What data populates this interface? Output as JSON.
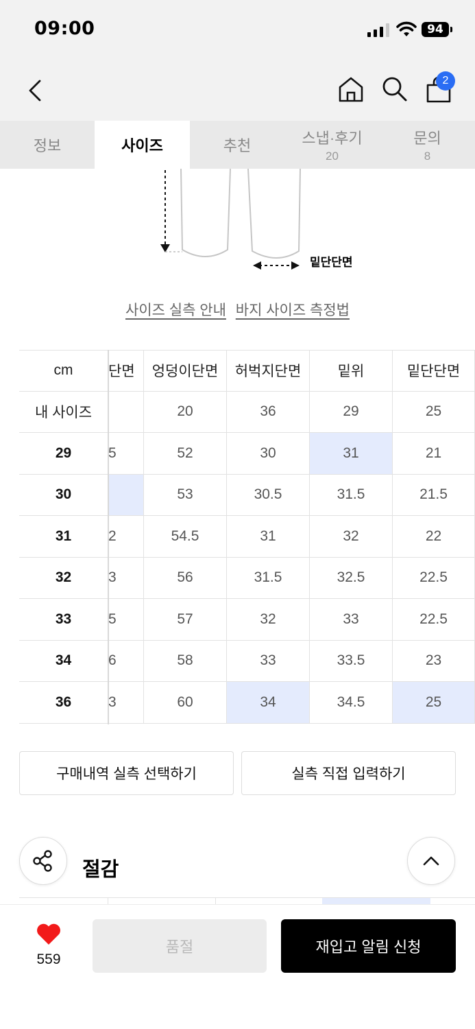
{
  "status_bar": {
    "time": "09:00",
    "battery": "94"
  },
  "nav": {
    "cart_count": "2"
  },
  "tabs": [
    {
      "label": "정보",
      "count": ""
    },
    {
      "label": "사이즈",
      "count": ""
    },
    {
      "label": "추천",
      "count": ""
    },
    {
      "label": "스냅·후기",
      "count": "20"
    },
    {
      "label": "문의",
      "count": "8"
    }
  ],
  "diagram": {
    "label": "밑단단면"
  },
  "guide_links": {
    "measure_guide": "사이즈 실측 안내",
    "pants_method": "바지 사이즈 측정법"
  },
  "size_table": {
    "headers": [
      "cm",
      "단면",
      "엉덩이단면",
      "허벅지단면",
      "밑위",
      "밑단단면"
    ],
    "rows": [
      {
        "label": "내 사이즈",
        "cells": [
          "",
          "20",
          "36",
          "29",
          "25"
        ]
      },
      {
        "label": "29",
        "cells": [
          "5",
          "52",
          "30",
          "31",
          "21"
        ]
      },
      {
        "label": "30",
        "cells": [
          "",
          "53",
          "30.5",
          "31.5",
          "21.5"
        ]
      },
      {
        "label": "31",
        "cells": [
          "2",
          "54.5",
          "31",
          "32",
          "22"
        ]
      },
      {
        "label": "32",
        "cells": [
          "3",
          "56",
          "31.5",
          "32.5",
          "22.5"
        ]
      },
      {
        "label": "33",
        "cells": [
          "5",
          "57",
          "32",
          "33",
          "22.5"
        ]
      },
      {
        "label": "34",
        "cells": [
          "6",
          "58",
          "33",
          "33.5",
          "23"
        ]
      },
      {
        "label": "36",
        "cells": [
          "3",
          "60",
          "34",
          "34.5",
          "25"
        ]
      }
    ]
  },
  "actions": {
    "select_purchase": "구매내역 실측 선택하기",
    "direct_input": "실측 직접 입력하기"
  },
  "fit_section": {
    "title": "절감"
  },
  "bottom_bar": {
    "like_count": "559",
    "soldout_label": "품절",
    "restock_label": "재입고 알림 신청"
  },
  "colors": {
    "accent": "#2a6df4",
    "highlight": "#e4ebfd",
    "like_red": "#f21a1a"
  }
}
